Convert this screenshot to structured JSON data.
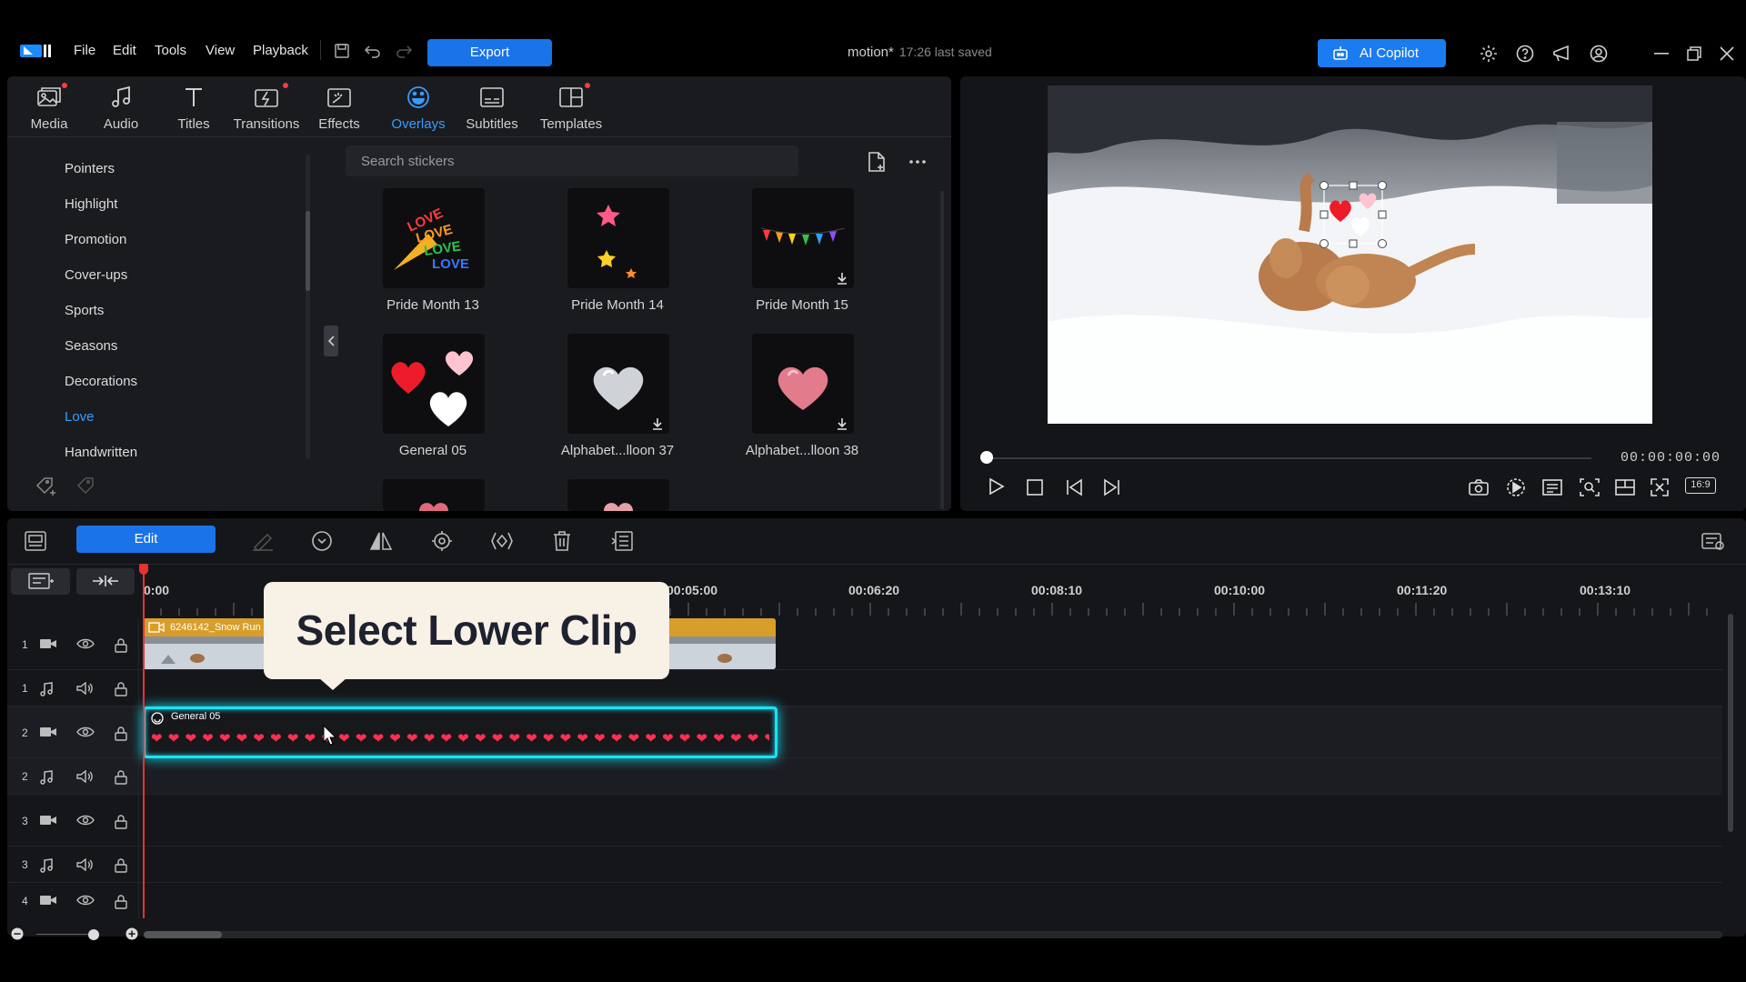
{
  "menu": {
    "file": "File",
    "edit": "Edit",
    "tools": "Tools",
    "view": "View",
    "playback": "Playback"
  },
  "toolbar": {
    "export_label": "Export",
    "copilot_label": "AI Copilot"
  },
  "document": {
    "name": "motion*",
    "saved": "17:26 last saved"
  },
  "tabs": [
    {
      "label": "Media",
      "icon": "media-icon"
    },
    {
      "label": "Audio",
      "icon": "music-note-icon"
    },
    {
      "label": "Titles",
      "icon": "text-icon"
    },
    {
      "label": "Transitions",
      "icon": "transition-icon"
    },
    {
      "label": "Effects",
      "icon": "effects-icon"
    },
    {
      "label": "Overlays",
      "icon": "overlays-icon",
      "active": true
    },
    {
      "label": "Subtitles",
      "icon": "subtitles-icon"
    },
    {
      "label": "Templates",
      "icon": "templates-icon"
    }
  ],
  "categories": [
    "Pointers",
    "Highlight",
    "Promotion",
    "Cover-ups",
    "Sports",
    "Seasons",
    "Decorations",
    "Love",
    "Handwritten"
  ],
  "active_category": "Love",
  "search": {
    "placeholder": "Search stickers"
  },
  "stickers": [
    {
      "label": "Pride Month 13"
    },
    {
      "label": "Pride Month 14"
    },
    {
      "label": "Pride Month 15"
    },
    {
      "label": "General 05"
    },
    {
      "label": "Alphabet...lloon 37"
    },
    {
      "label": "Alphabet...lloon 38"
    }
  ],
  "preview": {
    "timecode": "00:00:00:00",
    "aspect": "16:9"
  },
  "timeline": {
    "edit_label": "Edit",
    "ruler": [
      "0:00",
      "00:05:00",
      "00:06:20",
      "00:08:10",
      "00:10:00",
      "00:11:20",
      "00:13:10"
    ],
    "tracks": [
      {
        "num": "1",
        "type": "video"
      },
      {
        "num": "1",
        "type": "audio"
      },
      {
        "num": "2",
        "type": "video"
      },
      {
        "num": "2",
        "type": "audio"
      },
      {
        "num": "3",
        "type": "video"
      },
      {
        "num": "3",
        "type": "audio"
      },
      {
        "num": "4",
        "type": "video"
      }
    ],
    "clips": {
      "video": "6246142_Snow Run",
      "overlay": "General 05"
    },
    "callout": "Select Lower Clip"
  },
  "colors": {
    "accent": "#1a73e8",
    "active_tab": "#3a9bff",
    "selection_glow": "#19e3f0",
    "playhead": "#e53232"
  }
}
